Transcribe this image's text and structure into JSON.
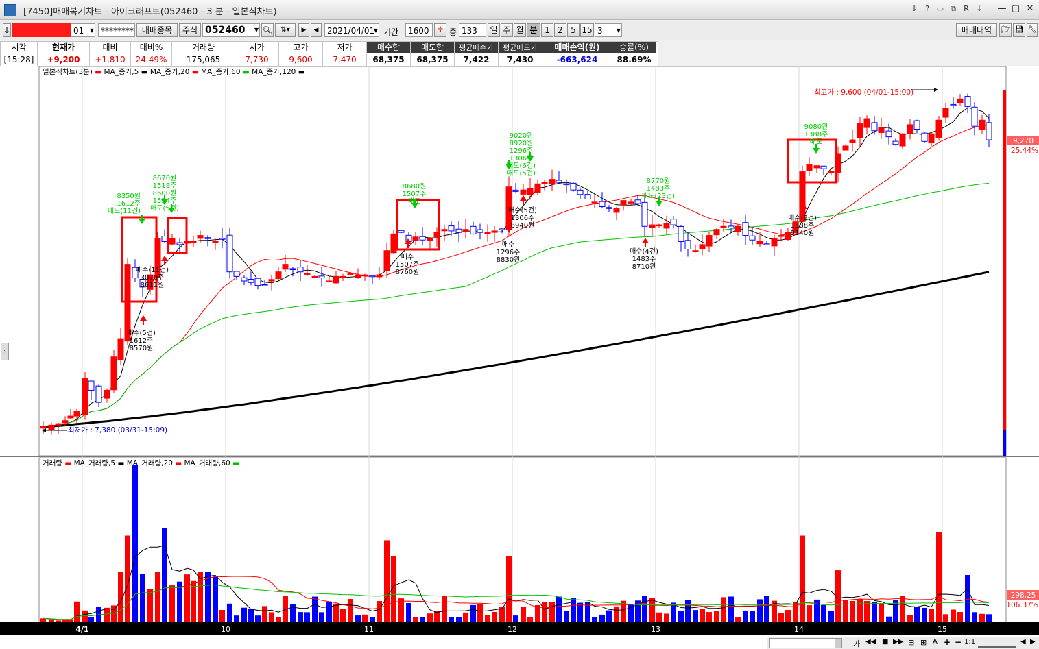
{
  "window": {
    "title": "[7450]매매복기차트 - 아이크래프트(052460 - 3 분 - 일본식차트)",
    "buttons": [
      "⇓",
      "?",
      "▭",
      "⧉",
      "R",
      "↓",
      "—",
      "▢",
      "✕"
    ]
  },
  "toolbar": {
    "dir": "↓",
    "acct_suffix": "01",
    "password": "********",
    "trade_item_btn": "매매종목",
    "type_btn": "주식",
    "code": "052460",
    "date": "2021/04/01",
    "period_label": "기간",
    "period_value": "1600",
    "count_label": "종",
    "count_value": "133",
    "tf_day": "일",
    "tf_week": "주",
    "tf_month": "월",
    "tf_min": "분",
    "min_opts": [
      "1",
      "2",
      "5",
      "15"
    ],
    "min_select": "3",
    "history_btn": "매매내역"
  },
  "info": {
    "headers": [
      "시각",
      "현재가",
      "대비",
      "대비%",
      "거래량",
      "시가",
      "고가",
      "저가",
      "매수합",
      "매도합",
      "평균매수가",
      "평균매도가",
      "매매손익(원)",
      "승률(%)"
    ],
    "values": [
      "[15:28]",
      "+9,200",
      "+1,810",
      "24.49%",
      "175,065",
      "7,730",
      "9,600",
      "7,470",
      "68,375",
      "68,375",
      "7,422",
      "7,430",
      "-663,624",
      "88.69%"
    ]
  },
  "chart": {
    "legend_price": [
      "일본식차트(3분)",
      "MA_종가,5",
      "MA_종가,20",
      "MA_종가,60",
      "MA_종가,120"
    ],
    "legend_volume": [
      "거래량",
      "MA_거래량,5",
      "MA_거래량,20",
      "MA_거래량,60"
    ],
    "high_label": "최고가 : 9,600 (04/01-15:00)",
    "low_label": "최저가 : 7,380 (03/31-15:09)",
    "price_tag": "9,270",
    "price_pct": "25.44%",
    "vol_tag": "298,25",
    "vol_pct": "106.37%",
    "x_labels": [
      "4/1",
      "10",
      "11",
      "12",
      "13",
      "14",
      "15"
    ],
    "colors": {
      "up": "#ff0000",
      "down": "#0000ff",
      "ma5": "#000000",
      "ma20": "#ff0000",
      "ma60": "#00c000",
      "ma120": "#000000",
      "sell": "#00cc00",
      "buy": "#ff0000"
    },
    "trade_labels": [
      {
        "kind": "sell",
        "lines": [
          "8350원",
          "1612주",
          "매도(11건)"
        ]
      },
      {
        "kind": "sell",
        "lines": [
          "8670원",
          "1518주",
          "8600원",
          "1554주",
          "매도(5건)"
        ]
      },
      {
        "kind": "buy",
        "lines": [
          "매수(11건)",
          "3070주",
          "8611원"
        ]
      },
      {
        "kind": "buy",
        "lines": [
          "매수(5건)",
          "1612주",
          "8570원"
        ]
      },
      {
        "kind": "sell",
        "lines": [
          "8680원",
          "1507주",
          "매도"
        ]
      },
      {
        "kind": "buy",
        "lines": [
          "매수",
          "1507주",
          "8760원"
        ]
      },
      {
        "kind": "sell",
        "lines": [
          "9020원",
          "8920원",
          "1296주",
          "1306주",
          "매도(6건)",
          "매도(5건)"
        ]
      },
      {
        "kind": "buy",
        "lines": [
          "매수(5건)",
          "1306주",
          "8940원"
        ]
      },
      {
        "kind": "buy",
        "lines": [
          "매수",
          "1296주",
          "8830원"
        ]
      },
      {
        "kind": "sell",
        "lines": [
          "8770원",
          "1483주",
          "매도(23건)"
        ]
      },
      {
        "kind": "buy",
        "lines": [
          "매수(4건)",
          "1483주",
          "8710원"
        ]
      },
      {
        "kind": "sell",
        "lines": [
          "9080원",
          "1388주",
          "매도"
        ]
      },
      {
        "kind": "buy",
        "lines": [
          "매수(9건)",
          "1388주",
          "9140원"
        ]
      }
    ],
    "status_icons": [
      "가",
      "◀◀",
      "■",
      "▶▶",
      "⊟",
      "⊞",
      "A",
      "+",
      "−",
      "1:1",
      "◀",
      "▶"
    ]
  }
}
